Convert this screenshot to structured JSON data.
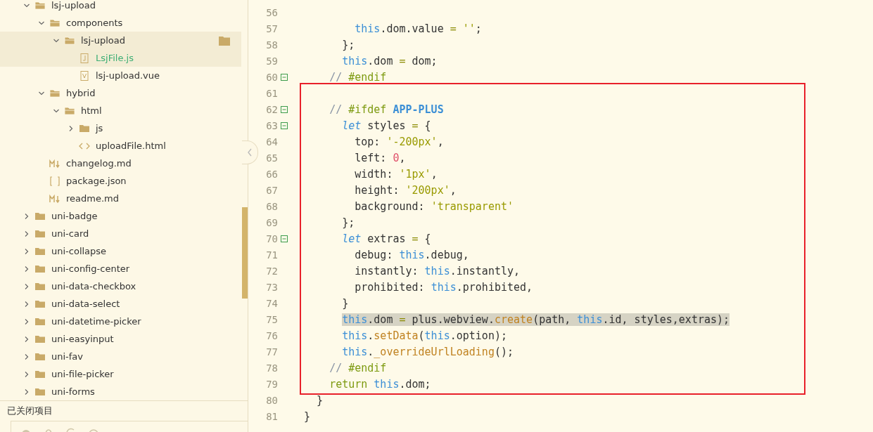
{
  "sidebar": {
    "tree": [
      {
        "name": "lsj-upload",
        "kind": "folder",
        "expanded": true,
        "selected": false,
        "children": [
          {
            "name": "components",
            "kind": "folder",
            "expanded": true,
            "selected": false,
            "children": [
              {
                "name": "lsj-upload",
                "kind": "folder",
                "expanded": true,
                "selected": true,
                "folder_action": true,
                "children": [
                  {
                    "name": "LsjFile.js",
                    "kind": "js",
                    "selected": true
                  },
                  {
                    "name": "lsj-upload.vue",
                    "kind": "vue",
                    "selected": false
                  }
                ]
              }
            ]
          },
          {
            "name": "hybrid",
            "kind": "folder",
            "expanded": true,
            "selected": false,
            "children": [
              {
                "name": "html",
                "kind": "folder",
                "expanded": true,
                "selected": false,
                "children": [
                  {
                    "name": "js",
                    "kind": "folder",
                    "expanded": false,
                    "selected": false
                  },
                  {
                    "name": "uploadFile.html",
                    "kind": "html",
                    "selected": false
                  }
                ]
              }
            ]
          },
          {
            "name": "changelog.md",
            "kind": "md",
            "selected": false
          },
          {
            "name": "package.json",
            "kind": "json",
            "selected": false
          },
          {
            "name": "readme.md",
            "kind": "md",
            "selected": false
          }
        ]
      },
      {
        "name": "uni-badge",
        "kind": "folder",
        "expanded": false,
        "selected": false
      },
      {
        "name": "uni-card",
        "kind": "folder",
        "expanded": false,
        "selected": false
      },
      {
        "name": "uni-collapse",
        "kind": "folder",
        "expanded": false,
        "selected": false
      },
      {
        "name": "uni-config-center",
        "kind": "folder",
        "expanded": false,
        "selected": false
      },
      {
        "name": "uni-data-checkbox",
        "kind": "folder",
        "expanded": false,
        "selected": false
      },
      {
        "name": "uni-data-select",
        "kind": "folder",
        "expanded": false,
        "selected": false
      },
      {
        "name": "uni-datetime-picker",
        "kind": "folder",
        "expanded": false,
        "selected": false
      },
      {
        "name": "uni-easyinput",
        "kind": "folder",
        "expanded": false,
        "selected": false
      },
      {
        "name": "uni-fav",
        "kind": "folder",
        "expanded": false,
        "selected": false
      },
      {
        "name": "uni-file-picker",
        "kind": "folder",
        "expanded": false,
        "selected": false
      },
      {
        "name": "uni-forms",
        "kind": "folder",
        "expanded": false,
        "selected": false
      }
    ],
    "closed_projects": {
      "label": "已关闭项目"
    }
  },
  "editor": {
    "blocks": [
      {
        "kind": "plain",
        "lines": [
          {
            "number": "56"
          },
          {
            "number": "57",
            "tokens": [
              {
                "kind": "kw",
                "text": "        this"
              },
              {
                "kind": "p",
                "text": ".dom.value "
              },
              {
                "kind": "op",
                "text": "="
              },
              {
                "kind": "str",
                "text": " ''"
              },
              {
                "kind": "p",
                "text": ";"
              }
            ]
          },
          {
            "number": "58",
            "tokens": [
              {
                "kind": "p",
                "text": "      };"
              }
            ]
          },
          {
            "number": "59",
            "tokens": [
              {
                "kind": "kw",
                "text": "      this"
              },
              {
                "kind": "p",
                "text": ".dom "
              },
              {
                "kind": "op",
                "text": "="
              },
              {
                "kind": "p",
                "text": " dom;"
              }
            ]
          },
          {
            "number": "60",
            "fold": true,
            "tokens": [
              {
                "kind": "cm",
                "text": "    // "
              },
              {
                "kind": "dir",
                "text": "#endif"
              }
            ]
          }
        ]
      },
      {
        "kind": "boxed",
        "lines": [
          {
            "number": "61"
          },
          {
            "number": "62",
            "fold": true,
            "tokens": [
              {
                "kind": "cm",
                "text": "    // "
              },
              {
                "kind": "dir",
                "text": "#ifdef "
              },
              {
                "kind": "const",
                "text": "APP-PLUS"
              }
            ]
          },
          {
            "number": "63",
            "fold": true,
            "tokens": [
              {
                "kind": "let",
                "text": "      let"
              },
              {
                "kind": "p",
                "text": " styles "
              },
              {
                "kind": "op",
                "text": "="
              },
              {
                "kind": "p",
                "text": " {"
              }
            ]
          },
          {
            "number": "64",
            "tokens": [
              {
                "kind": "p",
                "text": "        top: "
              },
              {
                "kind": "str",
                "text": "'-200px'"
              },
              {
                "kind": "p",
                "text": ","
              }
            ]
          },
          {
            "number": "65",
            "tokens": [
              {
                "kind": "p",
                "text": "        left: "
              },
              {
                "kind": "num",
                "text": "0"
              },
              {
                "kind": "p",
                "text": ","
              }
            ]
          },
          {
            "number": "66",
            "tokens": [
              {
                "kind": "p",
                "text": "        width: "
              },
              {
                "kind": "str",
                "text": "'1px'"
              },
              {
                "kind": "p",
                "text": ","
              }
            ]
          },
          {
            "number": "67",
            "tokens": [
              {
                "kind": "p",
                "text": "        height: "
              },
              {
                "kind": "str",
                "text": "'200px'"
              },
              {
                "kind": "p",
                "text": ","
              }
            ]
          },
          {
            "number": "68",
            "tokens": [
              {
                "kind": "p",
                "text": "        background: "
              },
              {
                "kind": "str",
                "text": "'transparent'"
              }
            ]
          },
          {
            "number": "69",
            "tokens": [
              {
                "kind": "p",
                "text": "      };"
              }
            ]
          },
          {
            "number": "70",
            "fold": true,
            "tokens": [
              {
                "kind": "let",
                "text": "      let"
              },
              {
                "kind": "p",
                "text": " extras "
              },
              {
                "kind": "op",
                "text": "="
              },
              {
                "kind": "p",
                "text": " {"
              }
            ]
          },
          {
            "number": "71",
            "tokens": [
              {
                "kind": "p",
                "text": "        debug: "
              },
              {
                "kind": "kw",
                "text": "this"
              },
              {
                "kind": "p",
                "text": ".debug,"
              }
            ]
          },
          {
            "number": "72",
            "tokens": [
              {
                "kind": "p",
                "text": "        instantly: "
              },
              {
                "kind": "kw",
                "text": "this"
              },
              {
                "kind": "p",
                "text": ".instantly,"
              }
            ]
          },
          {
            "number": "73",
            "tokens": [
              {
                "kind": "p",
                "text": "        prohibited: "
              },
              {
                "kind": "kw",
                "text": "this"
              },
              {
                "kind": "p",
                "text": ".prohibited,"
              }
            ]
          },
          {
            "number": "74",
            "tokens": [
              {
                "kind": "p",
                "text": "      }"
              }
            ]
          },
          {
            "number": "75",
            "highlighted": true,
            "tokens": [
              {
                "kind": "kw",
                "text": "      this"
              },
              {
                "kind": "p",
                "text": ".dom "
              },
              {
                "kind": "op",
                "text": "="
              },
              {
                "kind": "p",
                "text": " plus.webview."
              },
              {
                "kind": "fn",
                "text": "create"
              },
              {
                "kind": "p",
                "text": "(path, "
              },
              {
                "kind": "kw",
                "text": "this"
              },
              {
                "kind": "p",
                "text": ".id, styles,extras);"
              }
            ]
          },
          {
            "number": "76",
            "tokens": [
              {
                "kind": "kw",
                "text": "      this"
              },
              {
                "kind": "p",
                "text": "."
              },
              {
                "kind": "fn",
                "text": "setData"
              },
              {
                "kind": "p",
                "text": "("
              },
              {
                "kind": "kw",
                "text": "this"
              },
              {
                "kind": "p",
                "text": ".option);"
              }
            ]
          },
          {
            "number": "77",
            "tokens": [
              {
                "kind": "kw",
                "text": "      this"
              },
              {
                "kind": "p",
                "text": "."
              },
              {
                "kind": "fn",
                "text": "_overrideUrlLoading"
              },
              {
                "kind": "p",
                "text": "();"
              }
            ]
          },
          {
            "number": "78",
            "tokens": [
              {
                "kind": "cm",
                "text": "    // "
              },
              {
                "kind": "dir",
                "text": "#endif"
              }
            ]
          },
          {
            "number": "79",
            "tokens": [
              {
                "kind": "ret",
                "text": "    return"
              },
              {
                "kind": "kw",
                "text": " this"
              },
              {
                "kind": "p",
                "text": ".dom;"
              }
            ]
          }
        ]
      },
      {
        "kind": "plain",
        "lines": [
          {
            "number": "80",
            "tokens": [
              {
                "kind": "p",
                "text": "  }"
              }
            ]
          },
          {
            "number": "81",
            "tokens": [
              {
                "kind": "p",
                "text": "}"
              }
            ]
          }
        ]
      }
    ]
  }
}
